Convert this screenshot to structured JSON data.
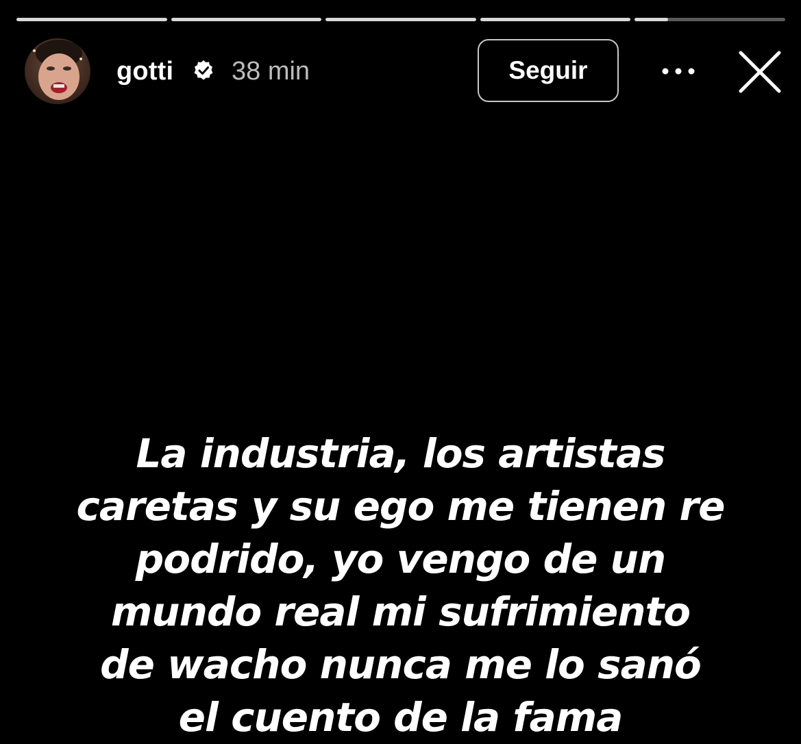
{
  "progress": {
    "segments": [
      1,
      1,
      1,
      1,
      0.22
    ]
  },
  "header": {
    "username": "gotti",
    "verified_icon": "verified-badge-icon",
    "time": "38 min",
    "follow_label": "Seguir",
    "more_icon": "more-horizontal-icon",
    "close_icon": "close-icon"
  },
  "story": {
    "lines": [
      "La industria, los artistas",
      "caretas y su ego me tienen re",
      "podrido, yo vengo de un",
      "mundo real mi sufrimiento",
      "de wacho nunca me lo sanó",
      "el cuento de la fama"
    ]
  },
  "colors": {
    "background": "#000000",
    "text": "#ffffff",
    "muted": "#bdbdbd",
    "progress_track": "#5a5a5a",
    "progress_fill": "#d9d9d9"
  }
}
